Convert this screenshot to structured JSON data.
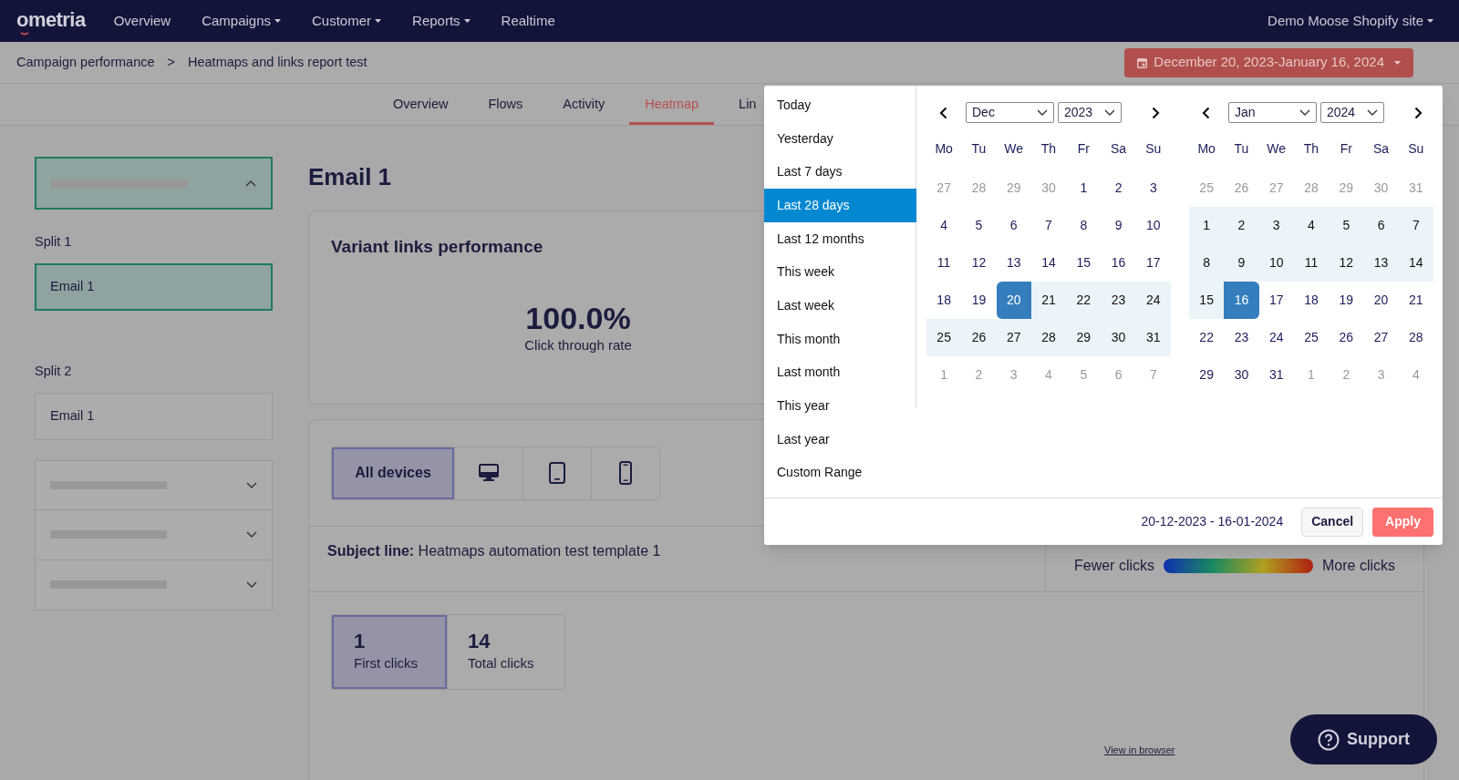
{
  "nav": {
    "logo": "ometria",
    "items": [
      {
        "label": "Overview",
        "dropdown": false
      },
      {
        "label": "Campaigns",
        "dropdown": true
      },
      {
        "label": "Customer",
        "dropdown": true
      },
      {
        "label": "Reports",
        "dropdown": true
      },
      {
        "label": "Realtime",
        "dropdown": false
      }
    ],
    "site": "Demo Moose Shopify site"
  },
  "breadcrumb": {
    "items": [
      "Campaign performance",
      "Heatmaps and links report test"
    ],
    "separator": ">"
  },
  "date_button": "December 20, 2023-January 16, 2024",
  "tabs": [
    {
      "label": "Overview",
      "selected": false
    },
    {
      "label": "Flows",
      "selected": false
    },
    {
      "label": "Activity",
      "selected": false
    },
    {
      "label": "Heatmap",
      "selected": true
    },
    {
      "label": "Lin",
      "selected": false
    }
  ],
  "sidebar": {
    "groups": [
      {
        "expanded": true,
        "splits": [
          {
            "label": "Split 1",
            "email": "Email 1",
            "selected": true
          },
          {
            "label": "Split 2",
            "email": "Email 1",
            "selected": false
          }
        ]
      },
      {
        "expanded": false
      },
      {
        "expanded": false
      },
      {
        "expanded": false
      }
    ]
  },
  "main": {
    "title": "Email 1",
    "card_title": "Variant links performance",
    "metric": "100.0%",
    "metric_label": "Click through rate",
    "devices": [
      {
        "kind": "all",
        "label": "All devices",
        "selected": true
      },
      {
        "kind": "desktop",
        "selected": false
      },
      {
        "kind": "tablet",
        "selected": false
      },
      {
        "kind": "mobile",
        "selected": false
      }
    ],
    "subject_label": "Subject line:",
    "subject": "Heatmaps automation test template 1",
    "legend": [
      "Fewer clicks",
      "More clicks"
    ],
    "click_tabs": [
      {
        "value": "1",
        "label": "First clicks",
        "selected": true
      },
      {
        "value": "14",
        "label": "Total clicks",
        "selected": false
      }
    ],
    "view_link": "View in browser"
  },
  "support": "Support",
  "picker": {
    "ranges": [
      {
        "label": "Today",
        "selected": false
      },
      {
        "label": "Yesterday",
        "selected": false
      },
      {
        "label": "Last 7 days",
        "selected": false
      },
      {
        "label": "Last 28 days",
        "selected": true
      },
      {
        "label": "Last 12 months",
        "selected": false
      },
      {
        "label": "This week",
        "selected": false
      },
      {
        "label": "Last week",
        "selected": false
      },
      {
        "label": "This month",
        "selected": false
      },
      {
        "label": "Last month",
        "selected": false
      },
      {
        "label": "This year",
        "selected": false
      },
      {
        "label": "Last year",
        "selected": false
      },
      {
        "label": "Custom Range",
        "selected": false
      }
    ],
    "calendars": [
      {
        "month": "Dec",
        "year": "2023",
        "weekdays": [
          "Mo",
          "Tu",
          "We",
          "Th",
          "Fr",
          "Sa",
          "Su"
        ],
        "weeks": [
          [
            {
              "d": "27",
              "kind": "off"
            },
            {
              "d": "28",
              "kind": "off"
            },
            {
              "d": "29",
              "kind": "off"
            },
            {
              "d": "30",
              "kind": "off"
            },
            {
              "d": "1",
              "kind": "day"
            },
            {
              "d": "2",
              "kind": "day"
            },
            {
              "d": "3",
              "kind": "day"
            }
          ],
          [
            {
              "d": "4",
              "kind": "day"
            },
            {
              "d": "5",
              "kind": "day"
            },
            {
              "d": "6",
              "kind": "day"
            },
            {
              "d": "7",
              "kind": "day"
            },
            {
              "d": "8",
              "kind": "day"
            },
            {
              "d": "9",
              "kind": "day"
            },
            {
              "d": "10",
              "kind": "day"
            }
          ],
          [
            {
              "d": "11",
              "kind": "day"
            },
            {
              "d": "12",
              "kind": "day"
            },
            {
              "d": "13",
              "kind": "day"
            },
            {
              "d": "14",
              "kind": "day"
            },
            {
              "d": "15",
              "kind": "day"
            },
            {
              "d": "16",
              "kind": "day"
            },
            {
              "d": "17",
              "kind": "day"
            }
          ],
          [
            {
              "d": "18",
              "kind": "day"
            },
            {
              "d": "19",
              "kind": "day"
            },
            {
              "d": "20",
              "kind": "start"
            },
            {
              "d": "21",
              "kind": "range"
            },
            {
              "d": "22",
              "kind": "range"
            },
            {
              "d": "23",
              "kind": "range"
            },
            {
              "d": "24",
              "kind": "range"
            }
          ],
          [
            {
              "d": "25",
              "kind": "range"
            },
            {
              "d": "26",
              "kind": "range"
            },
            {
              "d": "27",
              "kind": "range"
            },
            {
              "d": "28",
              "kind": "range"
            },
            {
              "d": "29",
              "kind": "range"
            },
            {
              "d": "30",
              "kind": "range"
            },
            {
              "d": "31",
              "kind": "range"
            }
          ],
          [
            {
              "d": "1",
              "kind": "off"
            },
            {
              "d": "2",
              "kind": "off"
            },
            {
              "d": "3",
              "kind": "off"
            },
            {
              "d": "4",
              "kind": "off"
            },
            {
              "d": "5",
              "kind": "off"
            },
            {
              "d": "6",
              "kind": "off"
            },
            {
              "d": "7",
              "kind": "off"
            }
          ]
        ]
      },
      {
        "month": "Jan",
        "year": "2024",
        "weekdays": [
          "Mo",
          "Tu",
          "We",
          "Th",
          "Fr",
          "Sa",
          "Su"
        ],
        "weeks": [
          [
            {
              "d": "25",
              "kind": "off"
            },
            {
              "d": "26",
              "kind": "off"
            },
            {
              "d": "27",
              "kind": "off"
            },
            {
              "d": "28",
              "kind": "off"
            },
            {
              "d": "29",
              "kind": "off"
            },
            {
              "d": "30",
              "kind": "off"
            },
            {
              "d": "31",
              "kind": "off"
            }
          ],
          [
            {
              "d": "1",
              "kind": "range"
            },
            {
              "d": "2",
              "kind": "range"
            },
            {
              "d": "3",
              "kind": "range"
            },
            {
              "d": "4",
              "kind": "range"
            },
            {
              "d": "5",
              "kind": "range"
            },
            {
              "d": "6",
              "kind": "range"
            },
            {
              "d": "7",
              "kind": "range"
            }
          ],
          [
            {
              "d": "8",
              "kind": "range"
            },
            {
              "d": "9",
              "kind": "range"
            },
            {
              "d": "10",
              "kind": "range"
            },
            {
              "d": "11",
              "kind": "range"
            },
            {
              "d": "12",
              "kind": "range"
            },
            {
              "d": "13",
              "kind": "range"
            },
            {
              "d": "14",
              "kind": "range"
            }
          ],
          [
            {
              "d": "15",
              "kind": "range"
            },
            {
              "d": "16",
              "kind": "end"
            },
            {
              "d": "17",
              "kind": "day"
            },
            {
              "d": "18",
              "kind": "day"
            },
            {
              "d": "19",
              "kind": "day"
            },
            {
              "d": "20",
              "kind": "day"
            },
            {
              "d": "21",
              "kind": "day"
            }
          ],
          [
            {
              "d": "22",
              "kind": "day"
            },
            {
              "d": "23",
              "kind": "day"
            },
            {
              "d": "24",
              "kind": "day"
            },
            {
              "d": "25",
              "kind": "day"
            },
            {
              "d": "26",
              "kind": "day"
            },
            {
              "d": "27",
              "kind": "day"
            },
            {
              "d": "28",
              "kind": "day"
            }
          ],
          [
            {
              "d": "29",
              "kind": "day"
            },
            {
              "d": "30",
              "kind": "day"
            },
            {
              "d": "31",
              "kind": "day"
            },
            {
              "d": "1",
              "kind": "off"
            },
            {
              "d": "2",
              "kind": "off"
            },
            {
              "d": "3",
              "kind": "off"
            },
            {
              "d": "4",
              "kind": "off"
            }
          ]
        ]
      }
    ],
    "range_text": "20-12-2023 - 16-01-2024",
    "cancel": "Cancel",
    "apply": "Apply"
  }
}
